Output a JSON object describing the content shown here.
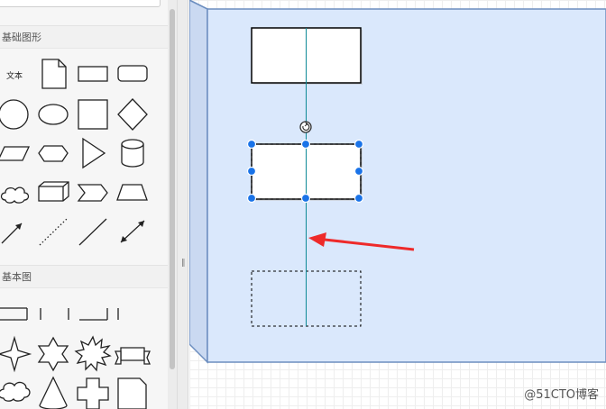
{
  "sidebar": {
    "sections": [
      {
        "title": "基础图形"
      },
      {
        "title": "基本图"
      }
    ],
    "basic_shapes": {
      "text_label": "文本",
      "items": [
        "text",
        "note",
        "rectangle",
        "rounded-rectangle",
        "ellipse-circle",
        "ellipse",
        "square",
        "diamond",
        "parallelogram",
        "hexagon",
        "triangle",
        "cylinder",
        "cloud",
        "cube",
        "step",
        "trapezoid",
        "arrow-line",
        "dotted-line",
        "line",
        "bidirectional-arrow"
      ]
    },
    "misc_shapes": {
      "items": [
        "bracket-left",
        "bracket-tick",
        "bracket-bottom",
        "bracket-right",
        "star-4",
        "star-6",
        "starburst",
        "banner",
        "cloud-callout",
        "cone",
        "cross",
        "folded-page"
      ]
    },
    "splitter_grip": "‖"
  },
  "canvas": {
    "container_fill": "#dae8fc",
    "container_stroke": "#6c8ebf",
    "guide_color": "#0e8a97",
    "selection_color": "#1a73e8",
    "arrow_color": "#ee2a2a"
  },
  "watermark": "@51CTO博客"
}
